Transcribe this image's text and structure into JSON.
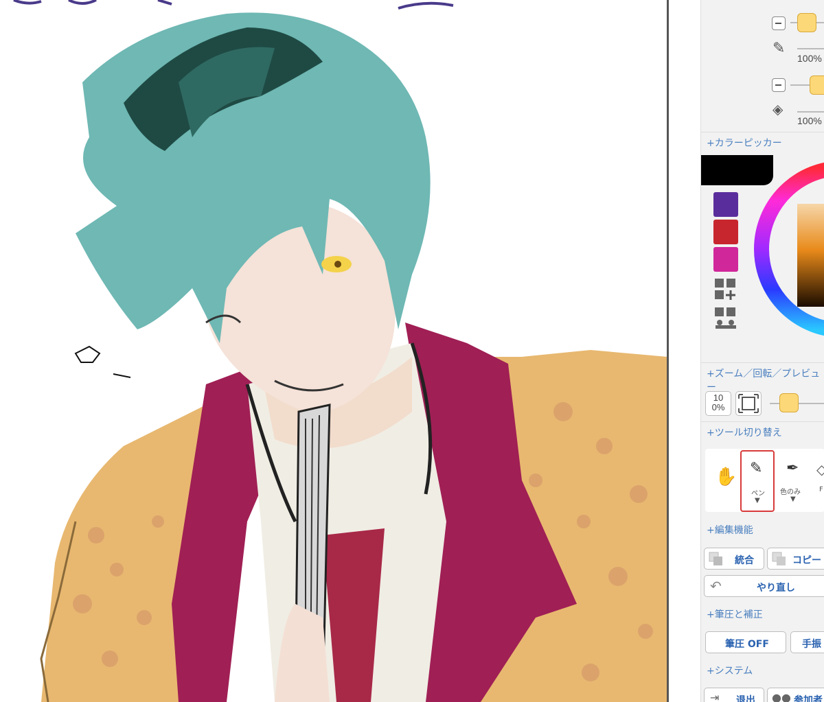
{
  "panel": {
    "brush1": {
      "opacity": "100%"
    },
    "brush2": {
      "opacity": "100%"
    },
    "sections": {
      "color_picker": "+カラーピッカー",
      "zoom": "+ズーム／回転／プレビュー",
      "tool_switch": "+ツール切り替え",
      "edit": "+編集機能",
      "pressure": "+筆圧と補正",
      "system": "+システム"
    },
    "palette": {
      "main_color": "#000000",
      "swatches": [
        "#5a2d9c",
        "#c8262e",
        "#d0279a"
      ]
    },
    "zoom": {
      "reset_label": "100%"
    },
    "tools": {
      "hand": {
        "icon": "hand-icon"
      },
      "pen": {
        "label": "ペン",
        "arrow": "▼"
      },
      "eyedropper": {
        "label": "色のみ",
        "arrow": "▼"
      },
      "fill": {
        "label": "F"
      }
    },
    "edit": {
      "merge_label": "統合",
      "copy_label": "コピー",
      "redo_label": "やり直し"
    },
    "pressure": {
      "pressure_label": "筆圧 OFF",
      "stabilizer_label": "手振"
    },
    "system": {
      "exit_label": "退出",
      "participants_label": "参加者"
    },
    "colors": {
      "accent": "#2a62b0",
      "selected_border": "#d83a3a",
      "slider_thumb": "#fcd878"
    }
  }
}
